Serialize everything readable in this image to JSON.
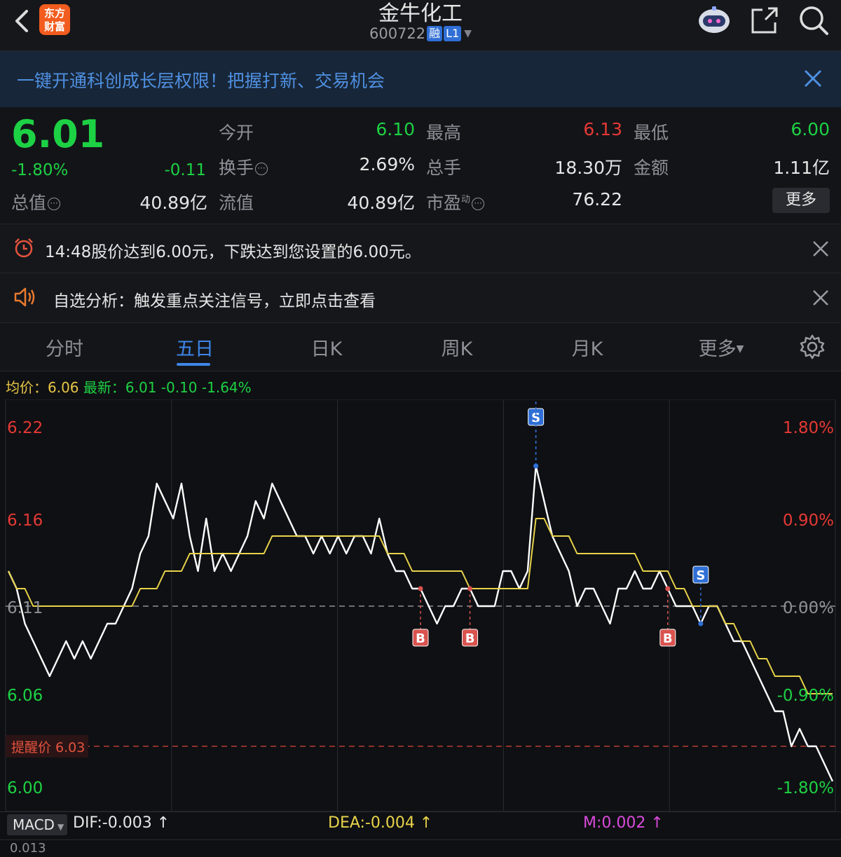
{
  "header": {
    "stock_name": "金牛化工",
    "code": "600722",
    "tag_margin": "融",
    "tag_level": "L1",
    "logo_line1": "东方",
    "logo_line2": "财富"
  },
  "banner": {
    "text": "一键开通科创成长层权限！把握打新、交易机会"
  },
  "quote": {
    "price": "6.01",
    "pct": "-1.80%",
    "change": "-0.11",
    "rows": [
      [
        {
          "label": "今开",
          "value": "6.10",
          "color": "green"
        },
        {
          "label": "最高",
          "value": "6.13",
          "color": "red"
        },
        {
          "label": "最低",
          "value": "6.00",
          "color": "green"
        }
      ],
      [
        {
          "label": "换手",
          "value": "2.69%",
          "color": "white"
        },
        {
          "label": "总手",
          "value": "18.30万",
          "color": "white"
        },
        {
          "label": "金额",
          "value": "1.11亿",
          "color": "white"
        }
      ]
    ],
    "row3": {
      "total_value_label": "总值",
      "total_value": "40.89亿",
      "float_label": "流值",
      "float_value": "40.89亿",
      "pe_label": "市盈",
      "pe_sup": "动",
      "pe_value": "76.22"
    },
    "more_label": "更多"
  },
  "alerts": {
    "price_alert": "14:48股价达到6.00元，下跌达到您设置的6.00元。",
    "analysis_alert": "自选分析：触发重点关注信号，立即点击查看"
  },
  "tabs": [
    "分时",
    "五日",
    "日K",
    "周K",
    "月K",
    "更多"
  ],
  "active_tab": "五日",
  "legend": {
    "avg_label": "均价：",
    "avg_value": "6.06",
    "latest_label": "最新：",
    "latest_value": "6.01",
    "change": "-0.10",
    "pct": "-1.64%"
  },
  "chart_data": {
    "type": "line",
    "y_left_ticks": [
      "6.22",
      "6.16",
      "6.11",
      "6.06",
      "6.00"
    ],
    "y_right_ticks": [
      "1.80%",
      "0.90%",
      "0.00%",
      "-0.90%",
      "-1.80%"
    ],
    "ylim": [
      6.0,
      6.22
    ],
    "alert_line": {
      "label": "提醒价 6.03",
      "value": 6.03
    },
    "day_count": 5,
    "series": [
      {
        "values": [
          6.13,
          6.12,
          6.1,
          6.09,
          6.08,
          6.07,
          6.08,
          6.09,
          6.08,
          6.09,
          6.08,
          6.09,
          6.1,
          6.1,
          6.11,
          6.12,
          6.14,
          6.15,
          6.18,
          6.17,
          6.16,
          6.18,
          6.15,
          6.13,
          6.16,
          6.13,
          6.14,
          6.13,
          6.14,
          6.15,
          6.17,
          6.16,
          6.18,
          6.17,
          6.16,
          6.15,
          6.15,
          6.14,
          6.15,
          6.14,
          6.15,
          6.14,
          6.15,
          6.15,
          6.14,
          6.16,
          6.14,
          6.13,
          6.13,
          6.12,
          6.12,
          6.11,
          6.1,
          6.11,
          6.11,
          6.12,
          6.12,
          6.11,
          6.11,
          6.11,
          6.13,
          6.13,
          6.12,
          6.13,
          6.19,
          6.17,
          6.15,
          6.14,
          6.13,
          6.11,
          6.12,
          6.12,
          6.11,
          6.1,
          6.12,
          6.12,
          6.13,
          6.12,
          6.12,
          6.13,
          6.12,
          6.11,
          6.11,
          6.11,
          6.1,
          6.11,
          6.11,
          6.1,
          6.09,
          6.09,
          6.08,
          6.07,
          6.06,
          6.05,
          6.05,
          6.03,
          6.04,
          6.03,
          6.03,
          6.02,
          6.01
        ]
      },
      {
        "values": [
          6.13,
          6.12,
          6.12,
          6.11,
          6.11,
          6.11,
          6.11,
          6.11,
          6.11,
          6.11,
          6.11,
          6.11,
          6.11,
          6.11,
          6.11,
          6.11,
          6.12,
          6.12,
          6.12,
          6.13,
          6.13,
          6.13,
          6.14,
          6.14,
          6.14,
          6.14,
          6.14,
          6.14,
          6.14,
          6.14,
          6.14,
          6.14,
          6.15,
          6.15,
          6.15,
          6.15,
          6.15,
          6.15,
          6.15,
          6.15,
          6.15,
          6.15,
          6.15,
          6.15,
          6.15,
          6.15,
          6.14,
          6.14,
          6.14,
          6.13,
          6.13,
          6.13,
          6.13,
          6.13,
          6.13,
          6.13,
          6.12,
          6.12,
          6.12,
          6.12,
          6.12,
          6.12,
          6.12,
          6.12,
          6.16,
          6.16,
          6.15,
          6.15,
          6.15,
          6.14,
          6.14,
          6.14,
          6.14,
          6.14,
          6.14,
          6.14,
          6.14,
          6.13,
          6.13,
          6.13,
          6.13,
          6.12,
          6.12,
          6.11,
          6.11,
          6.11,
          6.11,
          6.1,
          6.1,
          6.09,
          6.09,
          6.08,
          6.08,
          6.07,
          6.07,
          6.07,
          6.07,
          6.06,
          6.06,
          6.06,
          6.06
        ]
      }
    ]
  },
  "trade_marks": [
    {
      "type": "B",
      "index": 50
    },
    {
      "type": "B",
      "index": 56
    },
    {
      "type": "B",
      "index": 80
    },
    {
      "type": "S",
      "index": 64
    },
    {
      "type": "S",
      "index": 64
    },
    {
      "type": "S",
      "index": 84
    }
  ],
  "macd": {
    "select_label": "MACD",
    "dif": "DIF:-0.003",
    "dea": "DEA:-0.004",
    "m": "M:0.002",
    "top_value": "0.013"
  },
  "colors": {
    "up": "#e53935",
    "down": "#1dd144",
    "price_line": "#ffffff",
    "avg_line": "#e8d34a",
    "accent": "#3d86e8",
    "sell_mark": "#2f6fd6",
    "buy_mark": "#d9534f"
  }
}
